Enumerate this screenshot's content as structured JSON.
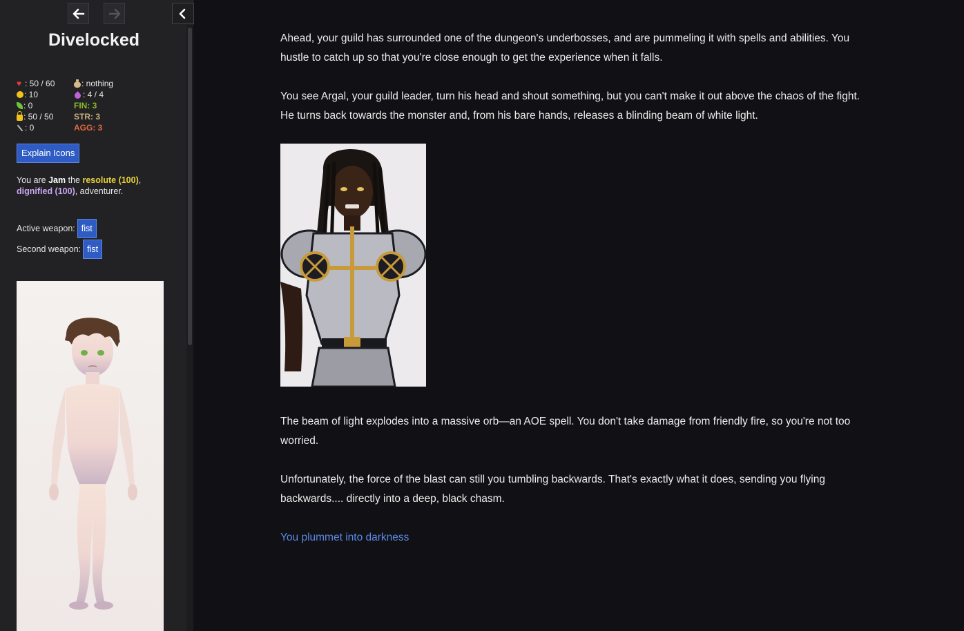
{
  "nav": {
    "back_icon": "arrow-left-icon",
    "forward_icon": "arrow-right-icon",
    "collapse_icon": "chevron-left-icon"
  },
  "sidebar": {
    "title": "Divelocked",
    "stats_left": [
      {
        "icon": "heart-icon",
        "value": ": 50 / 60"
      },
      {
        "icon": "coin-icon",
        "value": ": 10"
      },
      {
        "icon": "leaf-icon",
        "value": ": 0"
      },
      {
        "icon": "lock-icon",
        "value": ": 50 / 50"
      },
      {
        "icon": "wand-icon",
        "value": ": 0"
      }
    ],
    "stats_right": [
      {
        "icon": "sack-icon",
        "value": ": nothing"
      },
      {
        "icon": "drop-icon",
        "value": ": 4 / 4"
      },
      {
        "label": "FIN: 3"
      },
      {
        "label": "STR: 3"
      },
      {
        "label": "AGG: 3"
      }
    ],
    "explain_button": "Explain Icons",
    "identity": {
      "prefix": "You are ",
      "name": "Jam",
      "the": " the ",
      "trait1": "resolute (100)",
      "sep": ", ",
      "trait2": "dignified (100)",
      "suffix": ", adventurer."
    },
    "weapons": {
      "active_label": "Active weapon:",
      "active_value": "fist",
      "second_label": "Second weapon:",
      "second_value": "fist"
    }
  },
  "main": {
    "paragraphs": [
      "Ahead, your guild has surrounded one of the dungeon's underbosses, and are pummeling it with spells and abilities. You hustle to catch up so that you're close enough to get the experience when it falls.",
      "You see Argal, your guild leader, turn his head and shout something, but you can't make it out above the chaos of the fight. He turns back towards the monster and, from his bare hands, releases a blinding beam of white light.",
      "The beam of light explodes into a massive orb—an AOE spell. You don't take damage from friendly fire, so you're not too worried.",
      "Unfortunately, the force of the blast can still you tumbling backwards. That's exactly what it does, sending you flying backwards.... directly into a deep, black chasm."
    ],
    "continue_link": "You plummet into darkness"
  },
  "colors": {
    "background": "#111014",
    "sidebar": "#222225",
    "button_blue": "#2f5cc4",
    "link_blue": "#5b8ae6",
    "fin": "#8ab82a",
    "str": "#c8b080",
    "agg": "#e4683c",
    "trait_yellow": "#e8d23a",
    "trait_purple": "#c9a6f0"
  }
}
